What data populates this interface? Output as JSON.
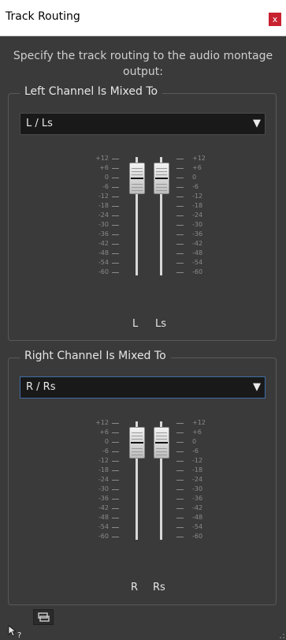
{
  "window": {
    "title": "Track Routing",
    "close_label": "x"
  },
  "instruction": "Specify the track routing to the audio montage output:",
  "left_group": {
    "legend": "Left Channel Is Mixed To",
    "selected": "L / Ls",
    "channel_a": "L",
    "channel_b": "Ls"
  },
  "right_group": {
    "legend": "Right Channel Is Mixed To",
    "selected": "R / Rs",
    "channel_a": "R",
    "channel_b": "Rs"
  },
  "scale_ticks": [
    "+12",
    "+6",
    "0",
    "-6",
    "-12",
    "-18",
    "-24",
    "-30",
    "-36",
    "-42",
    "-48",
    "-54",
    "-60"
  ],
  "fader_level_db": 0,
  "icons": {
    "dropdown": "dropdown-arrow-icon",
    "link": "link-faders-icon",
    "help": "help-pointer-icon",
    "resize": "resize-grip-icon"
  },
  "colors": {
    "close": "#c8212f",
    "focus_border": "#3f6da8",
    "background": "#3a3a3a"
  }
}
